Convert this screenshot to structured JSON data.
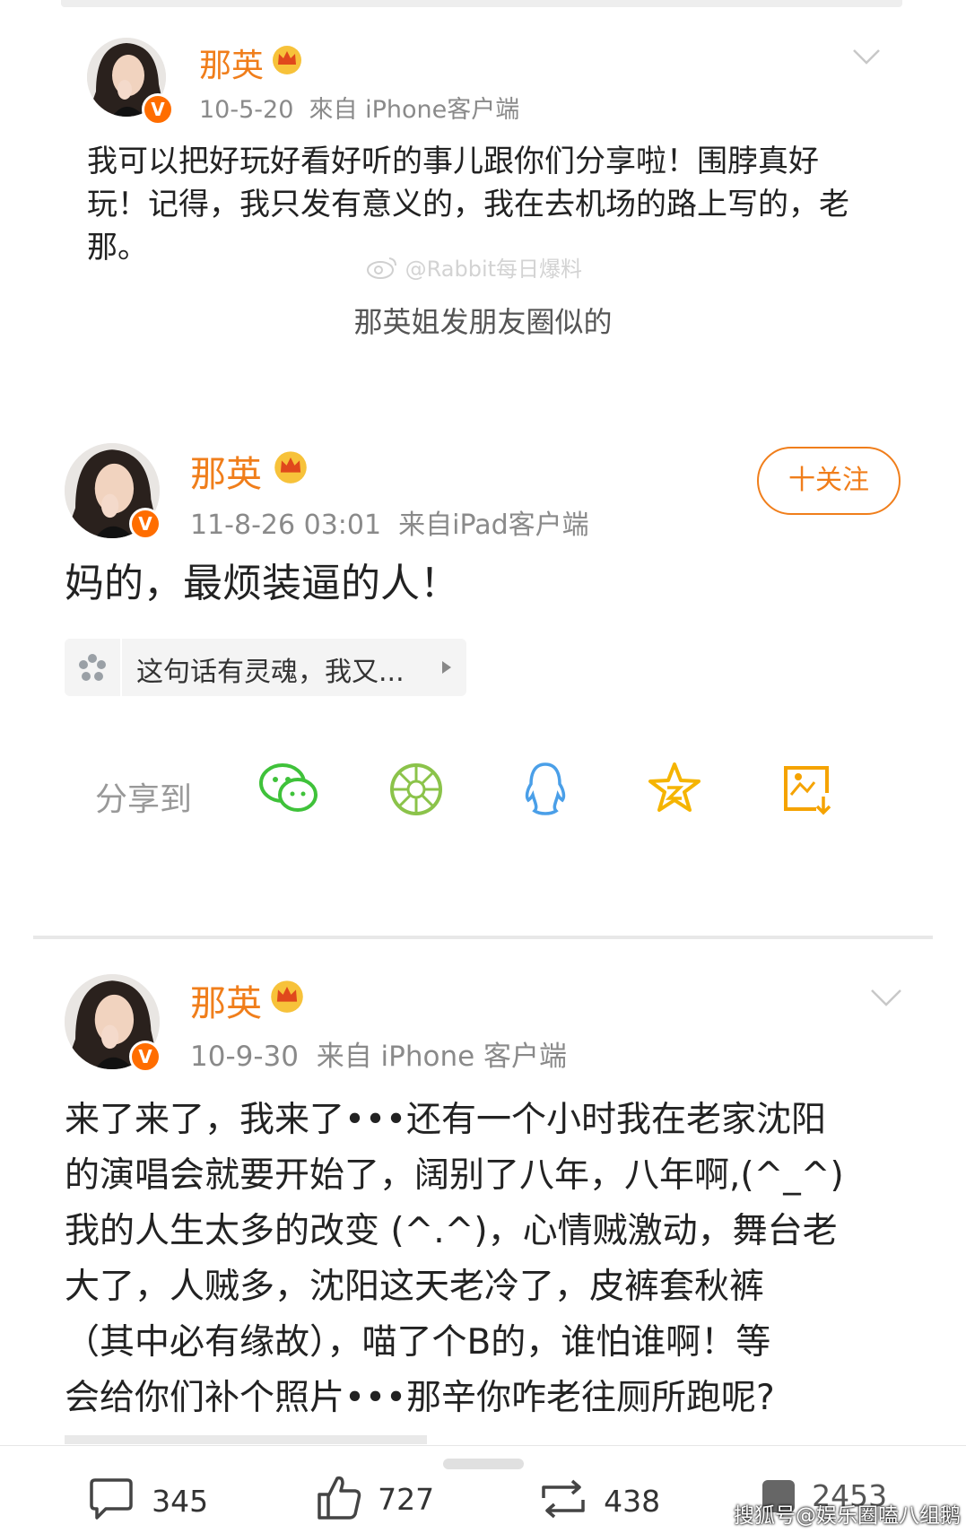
{
  "post1": {
    "author": "那英",
    "meta": "10-5-20  來自 iPhone客户端",
    "text_lines": [
      "我可以把好玩好看好听的事儿跟你们分享啦！围脖真好",
      "玩！记得，我只发有意义的，我在去机场的路上写的，老",
      "那。"
    ],
    "watermark": "@Rabbit每日爆料"
  },
  "caption": "那英姐发朋友圈似的",
  "post2": {
    "author": "那英",
    "meta": "11-8-26 03:01  来自iPad客户端",
    "follow_label": "十关注",
    "text": "妈的，最烦装逼的人！",
    "quote_text": "这句话有灵魂，我又...",
    "share_label": "分享到",
    "share_icons": [
      "wechat-icon",
      "moments-icon",
      "qq-icon",
      "qzone-icon",
      "save-image-icon"
    ]
  },
  "post3": {
    "author": "那英",
    "meta": "10-9-30  来自 iPhone 客户端",
    "text_lines": [
      "来了来了，我来了•••还有一个小时我在老家沈阳",
      "的演唱会就要开始了，阔别了八年，八年啊,(^_^)",
      "我的人生太多的改变 (^.^)，心情贼激动，舞台老",
      "大了，人贼多，沈阳这天老冷了，皮裤套秋裤",
      "（其中必有缘故），喵了个B的，谁怕谁啊！等",
      "会给你们补个照片•••那辛你咋老往厕所跑呢?"
    ]
  },
  "footer": {
    "comments": "345",
    "likes": "727",
    "reposts": "438",
    "other": "2453",
    "watermark": "搜狐号@娱乐圈嗑八组鹅"
  },
  "colors": {
    "accent": "#f07e1b",
    "badge": "#ff6d00",
    "wechat": "#3fc23a",
    "moments": "#8bc34a",
    "qq": "#4a9fe8",
    "qzone": "#f5b400"
  }
}
